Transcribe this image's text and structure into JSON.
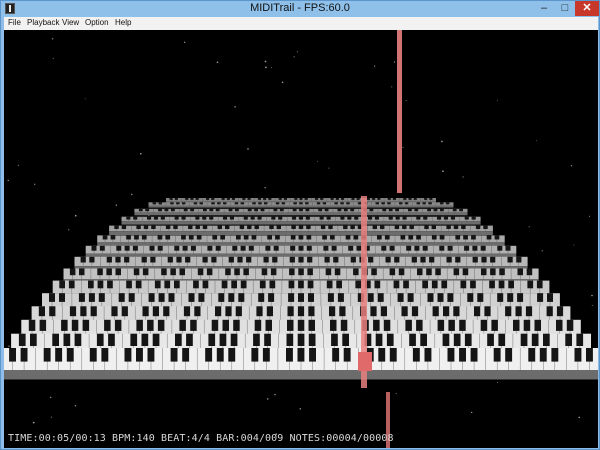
{
  "window": {
    "title": "MIDITrail - FPS:60.0"
  },
  "window_controls": {
    "minimize": "–",
    "maximize": "□",
    "close": "✕"
  },
  "menu": {
    "file": "File",
    "playback": "Playback",
    "view": "View",
    "option": "Option",
    "help": "Help"
  },
  "status": {
    "line": "TIME:00:05/00:13 BPM:140 BEAT:4/4 BAR:004/009 NOTES:00004/00008"
  },
  "colors": {
    "background": "#000000",
    "note_beam": "#e88080",
    "white_key": "#f0f0f0",
    "black_key": "#151515",
    "stats_text": "#d8d8d8",
    "titlebar": "#8ec0ea"
  },
  "icons": {
    "app": "midi-keyboard-icon"
  }
}
